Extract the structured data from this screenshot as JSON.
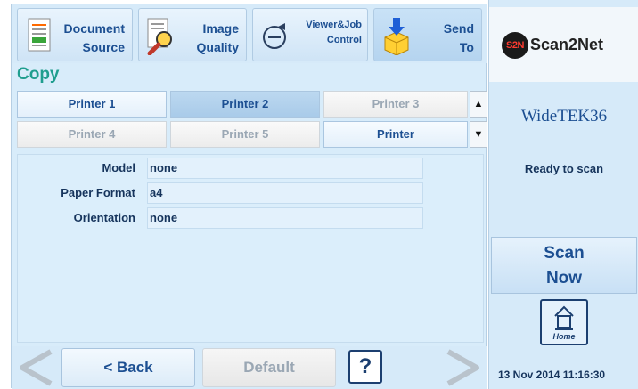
{
  "toolbar": {
    "buttons": [
      {
        "line1": "Document",
        "line2": "Source",
        "icon": "document-icon"
      },
      {
        "line1": "Image",
        "line2": "Quality",
        "icon": "magnifier-icon"
      },
      {
        "line1": "Viewer&Job",
        "line2": "Control",
        "icon": "viewer-control-icon"
      },
      {
        "line1": "Send",
        "line2": "To",
        "icon": "send-box-icon"
      }
    ]
  },
  "page_title": "Copy",
  "printers": {
    "tabs": [
      {
        "label": "Printer 1",
        "state": "enabled"
      },
      {
        "label": "Printer 2",
        "state": "selected"
      },
      {
        "label": "Printer 3",
        "state": "disabled"
      },
      {
        "label": "Printer 4",
        "state": "disabled"
      },
      {
        "label": "Printer 5",
        "state": "disabled"
      },
      {
        "label": "Printer",
        "state": "enabled"
      }
    ]
  },
  "properties": [
    {
      "label": "Model",
      "value": "none"
    },
    {
      "label": "Paper Format",
      "value": "a4"
    },
    {
      "label": "Orientation",
      "value": "none"
    }
  ],
  "bottom": {
    "back_label": "< Back",
    "default_label": "Default",
    "help_label": "?"
  },
  "side": {
    "logo_mark": "S2N",
    "logo_text": "Scan2Net",
    "device": "WideTEK36",
    "status": "Ready to scan",
    "scan_line1": "Scan",
    "scan_line2": "Now",
    "home_label": "Home",
    "datetime": "13 Nov 2014 11:16:30"
  },
  "colors": {
    "accent": "#1c4f92",
    "title": "#1f9e8e",
    "panel": "#d8ecfa"
  }
}
